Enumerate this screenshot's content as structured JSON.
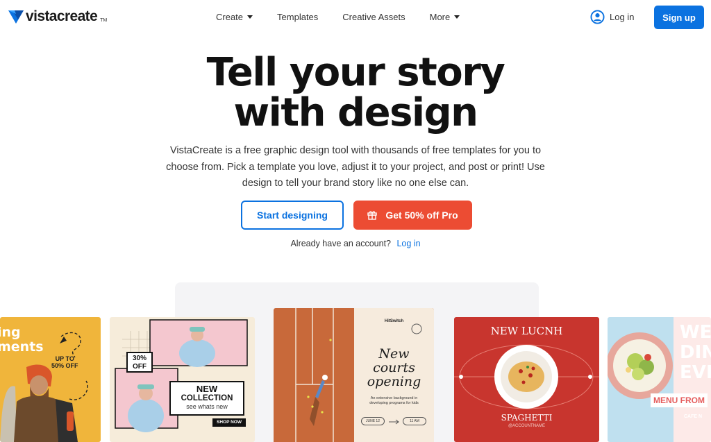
{
  "nav": {
    "brand": "vistacreate",
    "brand_tm": "TM",
    "menu": [
      {
        "label": "Create",
        "dropdown": true
      },
      {
        "label": "Templates",
        "dropdown": false
      },
      {
        "label": "Creative Assets",
        "dropdown": false
      },
      {
        "label": "More",
        "dropdown": true
      }
    ],
    "login_label": "Log in",
    "signup_label": "Sign up"
  },
  "hero": {
    "title_line1": "Tell your story",
    "title_line2": "with design",
    "description": "VistaCreate is a free graphic design tool with thousands of free templates for you to choose from. Pick a template you love, adjust it to your project, and post or print! Use design to tell your brand story like no one else can.",
    "start_label": "Start designing",
    "pro_label": "Get 50% off Pro",
    "already_text": "Already have an account?",
    "already_link": "Log in"
  },
  "cards": {
    "card1": {
      "line1": "ing",
      "line2": "ments",
      "upto": "UP TO",
      "discount": "50% OFF"
    },
    "card2": {
      "badge_line1": "30%",
      "badge_line2": "OFF",
      "new": "NEW",
      "collection": "COLLECTION",
      "sub": "see whats new",
      "shop": "SHOP NOW"
    },
    "card3": {
      "brand": "HitSwitch",
      "h1": "New",
      "h2": "courts",
      "h3": "opening",
      "sub": "An extensive background in developing programs for kids",
      "pill_left": "JUNE 12",
      "pill_right": "11 AM"
    },
    "card4": {
      "title": "NEW LUCNH",
      "dish": "SPAGHETTI",
      "account": "@ACCOUNTNAME"
    },
    "card5": {
      "l1": "WE",
      "l2": "DIN",
      "l3": "EVE",
      "menu": "MENU FROM",
      "cafe": "CAFE N"
    }
  },
  "colors": {
    "accent_blue": "#0b72e0",
    "promo_red": "#ec4c33"
  },
  "icons": {
    "logo": "vistacreate-logo-icon",
    "user": "user-circle-icon",
    "gift": "gift-icon",
    "caret": "caret-down-icon"
  }
}
